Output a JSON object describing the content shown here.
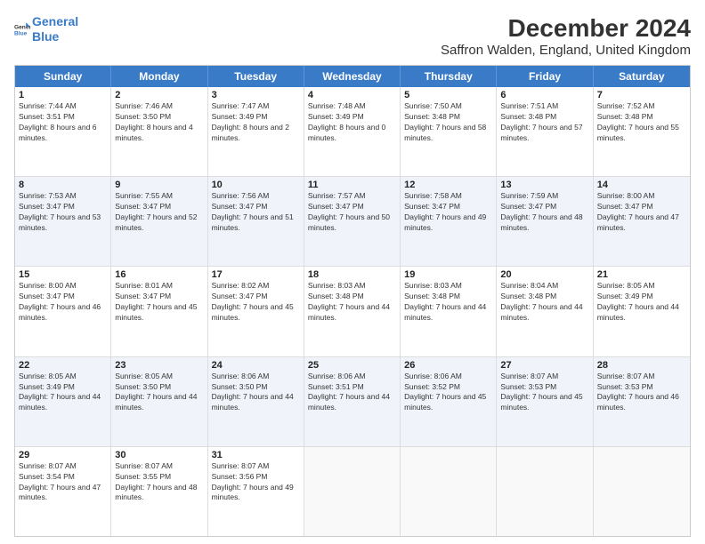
{
  "logo": {
    "line1": "General",
    "line2": "Blue"
  },
  "title": "December 2024",
  "subtitle": "Saffron Walden, England, United Kingdom",
  "headers": [
    "Sunday",
    "Monday",
    "Tuesday",
    "Wednesday",
    "Thursday",
    "Friday",
    "Saturday"
  ],
  "weeks": [
    [
      {
        "day": "1",
        "sunrise": "7:44 AM",
        "sunset": "3:51 PM",
        "daylight": "8 hours and 6 minutes."
      },
      {
        "day": "2",
        "sunrise": "7:46 AM",
        "sunset": "3:50 PM",
        "daylight": "8 hours and 4 minutes."
      },
      {
        "day": "3",
        "sunrise": "7:47 AM",
        "sunset": "3:49 PM",
        "daylight": "8 hours and 2 minutes."
      },
      {
        "day": "4",
        "sunrise": "7:48 AM",
        "sunset": "3:49 PM",
        "daylight": "8 hours and 0 minutes."
      },
      {
        "day": "5",
        "sunrise": "7:50 AM",
        "sunset": "3:48 PM",
        "daylight": "7 hours and 58 minutes."
      },
      {
        "day": "6",
        "sunrise": "7:51 AM",
        "sunset": "3:48 PM",
        "daylight": "7 hours and 57 minutes."
      },
      {
        "day": "7",
        "sunrise": "7:52 AM",
        "sunset": "3:48 PM",
        "daylight": "7 hours and 55 minutes."
      }
    ],
    [
      {
        "day": "8",
        "sunrise": "7:53 AM",
        "sunset": "3:47 PM",
        "daylight": "7 hours and 53 minutes."
      },
      {
        "day": "9",
        "sunrise": "7:55 AM",
        "sunset": "3:47 PM",
        "daylight": "7 hours and 52 minutes."
      },
      {
        "day": "10",
        "sunrise": "7:56 AM",
        "sunset": "3:47 PM",
        "daylight": "7 hours and 51 minutes."
      },
      {
        "day": "11",
        "sunrise": "7:57 AM",
        "sunset": "3:47 PM",
        "daylight": "7 hours and 50 minutes."
      },
      {
        "day": "12",
        "sunrise": "7:58 AM",
        "sunset": "3:47 PM",
        "daylight": "7 hours and 49 minutes."
      },
      {
        "day": "13",
        "sunrise": "7:59 AM",
        "sunset": "3:47 PM",
        "daylight": "7 hours and 48 minutes."
      },
      {
        "day": "14",
        "sunrise": "8:00 AM",
        "sunset": "3:47 PM",
        "daylight": "7 hours and 47 minutes."
      }
    ],
    [
      {
        "day": "15",
        "sunrise": "8:00 AM",
        "sunset": "3:47 PM",
        "daylight": "7 hours and 46 minutes."
      },
      {
        "day": "16",
        "sunrise": "8:01 AM",
        "sunset": "3:47 PM",
        "daylight": "7 hours and 45 minutes."
      },
      {
        "day": "17",
        "sunrise": "8:02 AM",
        "sunset": "3:47 PM",
        "daylight": "7 hours and 45 minutes."
      },
      {
        "day": "18",
        "sunrise": "8:03 AM",
        "sunset": "3:48 PM",
        "daylight": "7 hours and 44 minutes."
      },
      {
        "day": "19",
        "sunrise": "8:03 AM",
        "sunset": "3:48 PM",
        "daylight": "7 hours and 44 minutes."
      },
      {
        "day": "20",
        "sunrise": "8:04 AM",
        "sunset": "3:48 PM",
        "daylight": "7 hours and 44 minutes."
      },
      {
        "day": "21",
        "sunrise": "8:05 AM",
        "sunset": "3:49 PM",
        "daylight": "7 hours and 44 minutes."
      }
    ],
    [
      {
        "day": "22",
        "sunrise": "8:05 AM",
        "sunset": "3:49 PM",
        "daylight": "7 hours and 44 minutes."
      },
      {
        "day": "23",
        "sunrise": "8:05 AM",
        "sunset": "3:50 PM",
        "daylight": "7 hours and 44 minutes."
      },
      {
        "day": "24",
        "sunrise": "8:06 AM",
        "sunset": "3:50 PM",
        "daylight": "7 hours and 44 minutes."
      },
      {
        "day": "25",
        "sunrise": "8:06 AM",
        "sunset": "3:51 PM",
        "daylight": "7 hours and 44 minutes."
      },
      {
        "day": "26",
        "sunrise": "8:06 AM",
        "sunset": "3:52 PM",
        "daylight": "7 hours and 45 minutes."
      },
      {
        "day": "27",
        "sunrise": "8:07 AM",
        "sunset": "3:53 PM",
        "daylight": "7 hours and 45 minutes."
      },
      {
        "day": "28",
        "sunrise": "8:07 AM",
        "sunset": "3:53 PM",
        "daylight": "7 hours and 46 minutes."
      }
    ],
    [
      {
        "day": "29",
        "sunrise": "8:07 AM",
        "sunset": "3:54 PM",
        "daylight": "7 hours and 47 minutes."
      },
      {
        "day": "30",
        "sunrise": "8:07 AM",
        "sunset": "3:55 PM",
        "daylight": "7 hours and 48 minutes."
      },
      {
        "day": "31",
        "sunrise": "8:07 AM",
        "sunset": "3:56 PM",
        "daylight": "7 hours and 49 minutes."
      },
      null,
      null,
      null,
      null
    ]
  ]
}
